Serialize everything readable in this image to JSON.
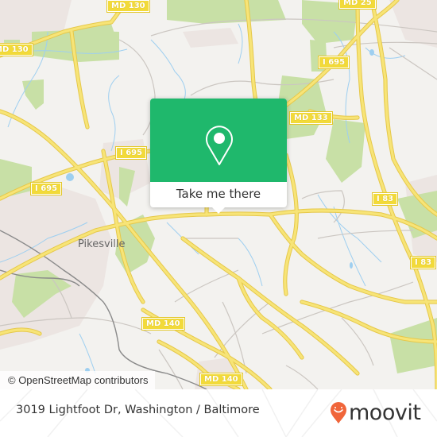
{
  "map": {
    "place_labels": [
      {
        "id": "pikesville",
        "text": "Pikesville"
      }
    ],
    "road_shields": [
      {
        "id": "md130-top",
        "text": "MD 130"
      },
      {
        "id": "md130-left",
        "text": "MD 130"
      },
      {
        "id": "md25",
        "text": "MD 25"
      },
      {
        "id": "i695-ne",
        "text": "I 695"
      },
      {
        "id": "md133",
        "text": "MD 133"
      },
      {
        "id": "i695-center",
        "text": "I 695"
      },
      {
        "id": "i695-west",
        "text": "I 695"
      },
      {
        "id": "i83-upper",
        "text": "I 83"
      },
      {
        "id": "i83-lower",
        "text": "I 83"
      },
      {
        "id": "md140-upper",
        "text": "MD 140"
      },
      {
        "id": "md140-lower",
        "text": "MD 140"
      }
    ],
    "attribution": "© OpenStreetMap contributors",
    "colors": {
      "land": "#f3f2ef",
      "park": "#c8e0a6",
      "water": "#8fc8ec",
      "major_road": "#f5e06a",
      "minor_road": "#c9c4bf",
      "urban": "#ece4e0",
      "rail": "#888888"
    }
  },
  "popup": {
    "icon": "location-pin-icon",
    "button_label": "Take me there",
    "accent_color": "#1fb86c"
  },
  "footer": {
    "address": "3019 Lightfoot Dr, Washington / Baltimore",
    "brand": "moovit",
    "brand_color": "#f0653a"
  }
}
